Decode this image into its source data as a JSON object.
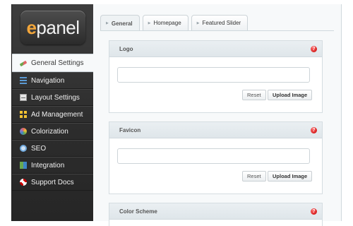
{
  "logo": {
    "accent": "e",
    "rest": "panel",
    "accent_color": "#f3a63a"
  },
  "sidebar": {
    "items": [
      {
        "label": "General Settings",
        "icon": "general-settings-icon",
        "active": true
      },
      {
        "label": "Navigation",
        "icon": "navigation-icon"
      },
      {
        "label": "Layout Settings",
        "icon": "layout-settings-icon"
      },
      {
        "label": "Ad Management",
        "icon": "ad-management-icon"
      },
      {
        "label": "Colorization",
        "icon": "colorization-icon"
      },
      {
        "label": "SEO",
        "icon": "seo-icon"
      },
      {
        "label": "Integration",
        "icon": "integration-icon"
      },
      {
        "label": "Support Docs",
        "icon": "support-docs-icon"
      }
    ]
  },
  "tabs": [
    {
      "label": "General",
      "active": true
    },
    {
      "label": "Homepage"
    },
    {
      "label": "Featured Slider"
    }
  ],
  "sections": {
    "logo": {
      "title": "Logo",
      "value": "",
      "reset": "Reset",
      "upload": "Upload Image"
    },
    "favicon": {
      "title": "Favicon",
      "value": "",
      "reset": "Reset",
      "upload": "Upload Image"
    },
    "color_scheme": {
      "title": "Color Scheme"
    }
  },
  "help_glyph": "?",
  "colors": {
    "sidebar_bg": "#2f2f2f",
    "panel_bg": "#f7f9fa",
    "help_red": "#cc0000"
  }
}
